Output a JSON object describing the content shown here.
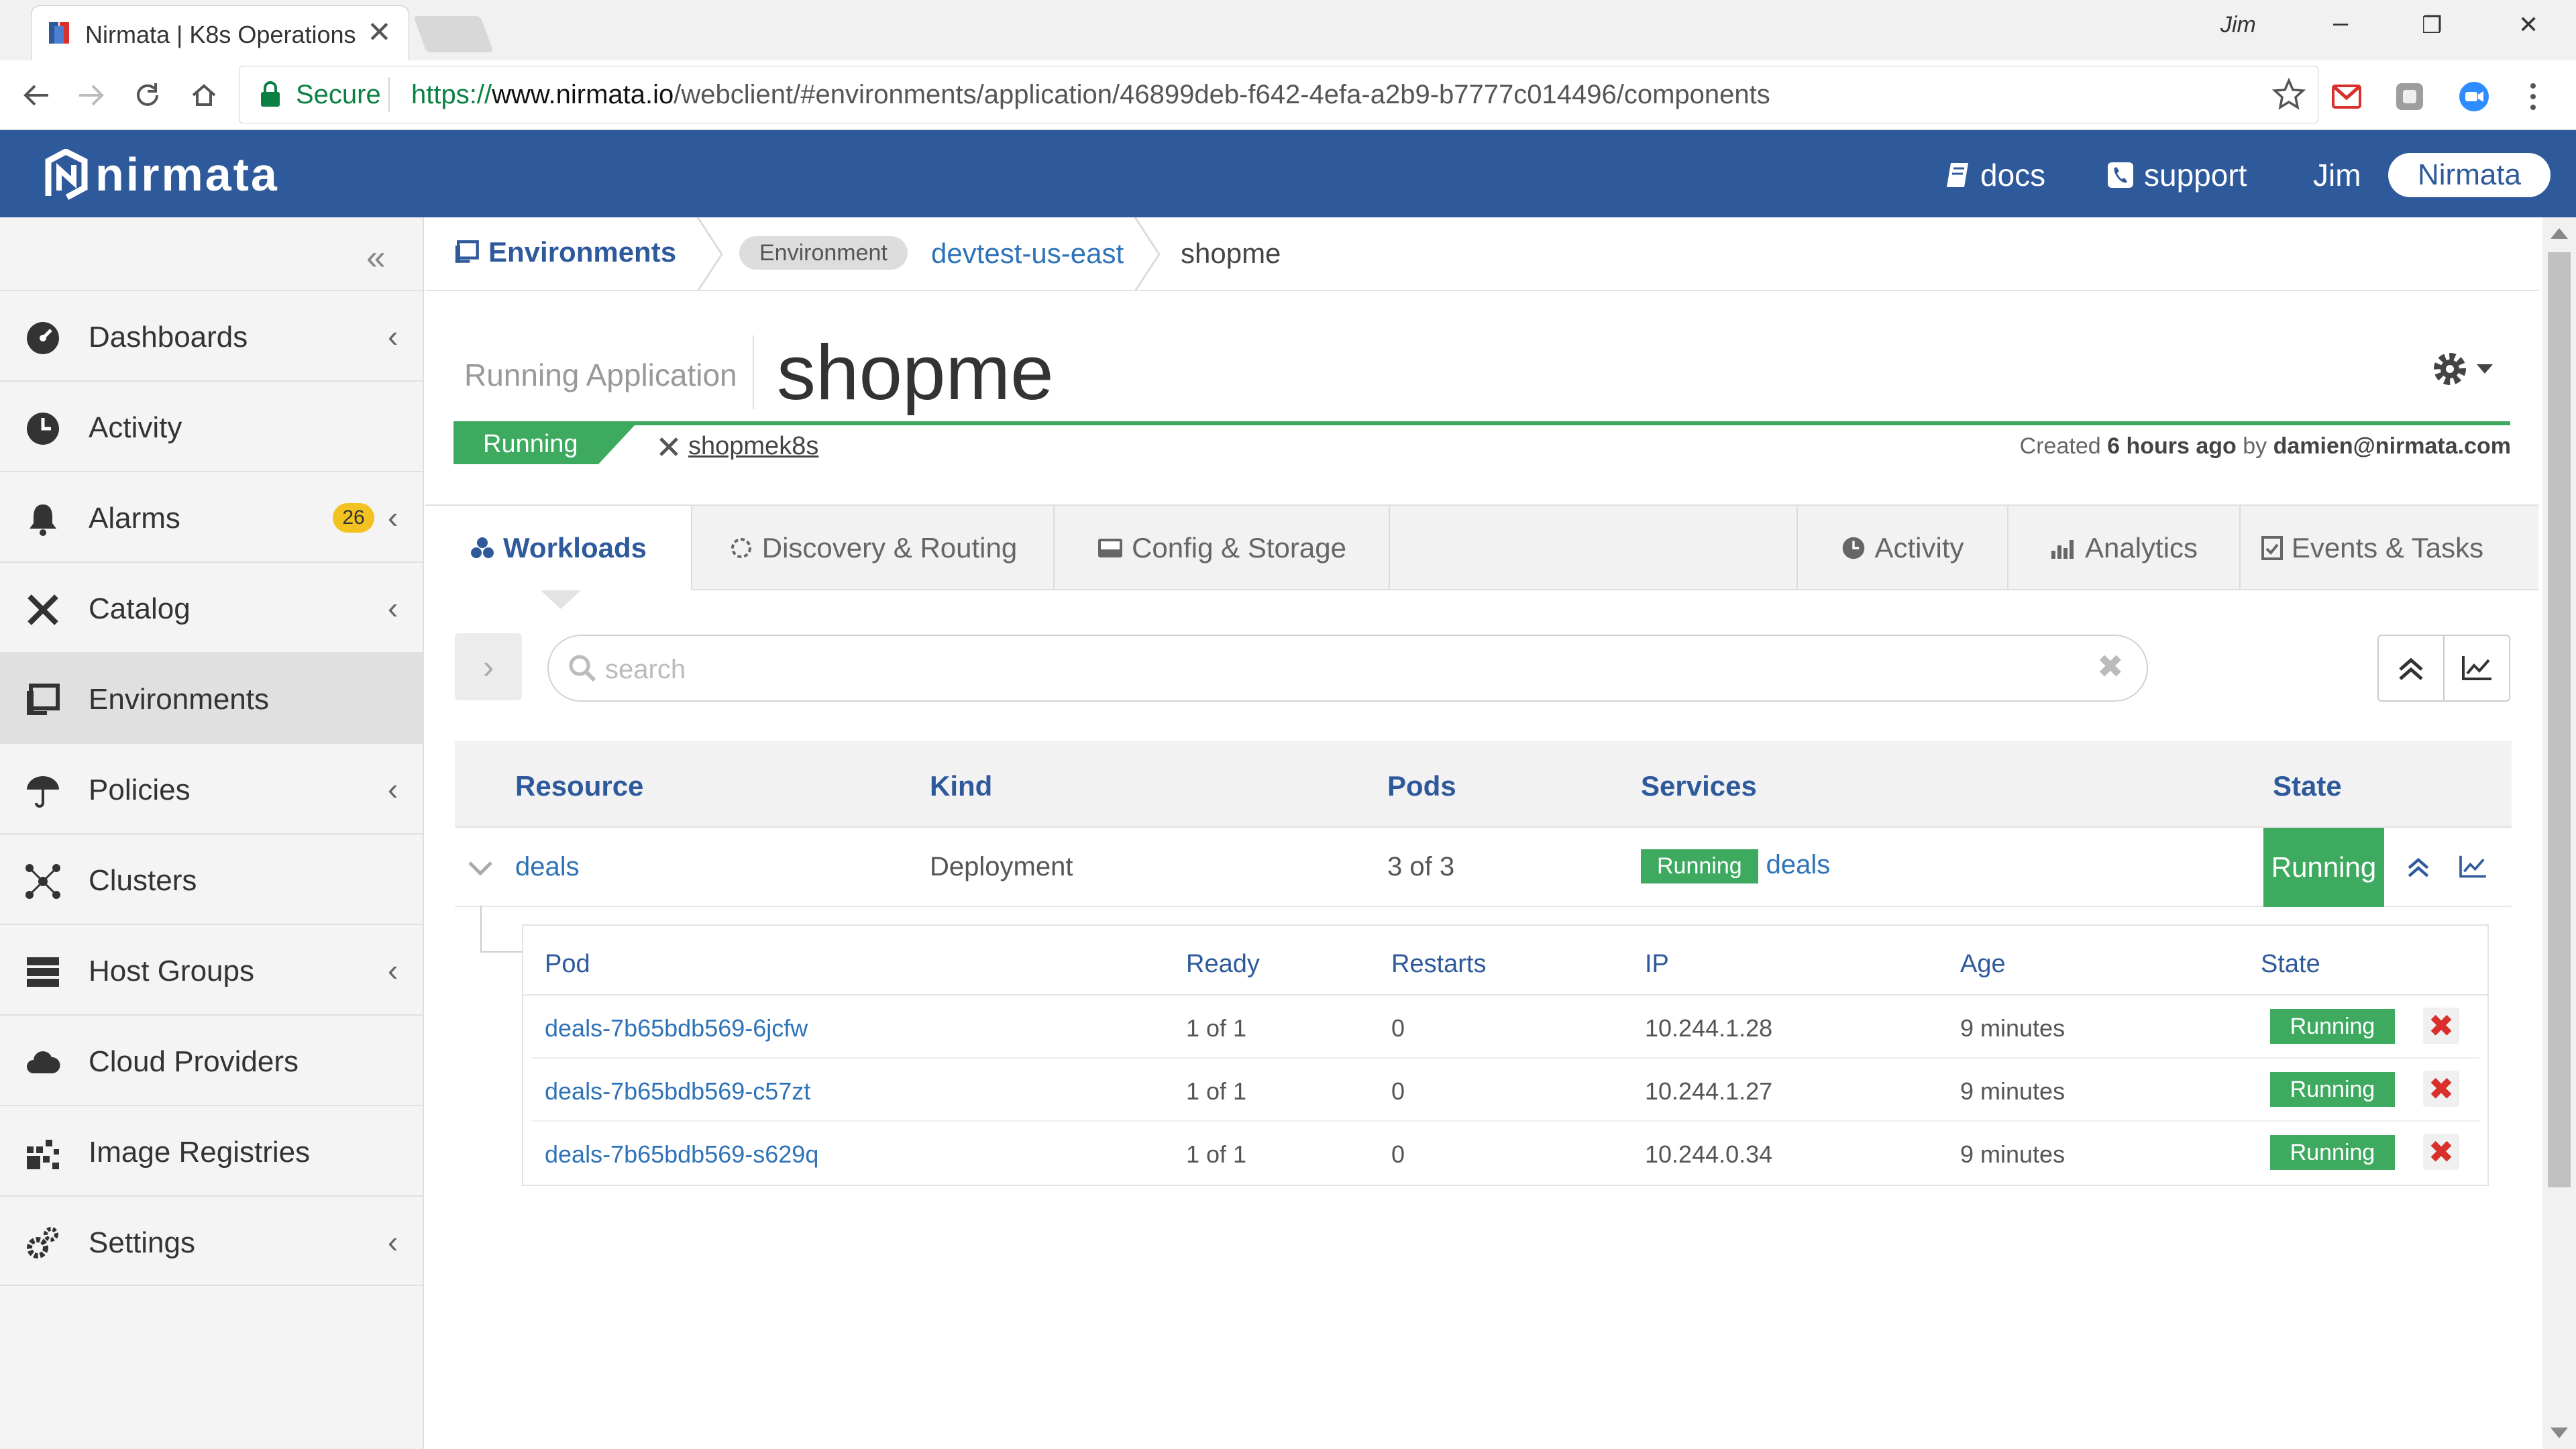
{
  "browser": {
    "tab_title": "Nirmata | K8s Operations",
    "profile_name": "Jim",
    "window_controls": {
      "minimize": "–",
      "restore": "❐",
      "close": "✕"
    },
    "tab_close": "✕",
    "omnibox": {
      "secure_label": "Secure",
      "url_scheme": "https://",
      "url_host": "www.nirmata.io",
      "url_path": "/webclient/#environments/application/46899deb-f642-4efa-a2b9-b7777c014496/components"
    }
  },
  "header": {
    "logo_text": "nirmata",
    "docs_label": "docs",
    "support_label": "support",
    "user_name": "Jim",
    "org_label": "Nirmata",
    "brand_color": "#2e5a9c"
  },
  "sidebar": {
    "collapse_glyph": "«",
    "items": [
      {
        "label": "Dashboards",
        "icon": "dashboard-icon",
        "chevron": "‹"
      },
      {
        "label": "Activity",
        "icon": "clock-icon"
      },
      {
        "label": "Alarms",
        "icon": "bell-icon",
        "badge": "26",
        "chevron": "‹"
      },
      {
        "label": "Catalog",
        "icon": "tools-icon",
        "chevron": "‹"
      },
      {
        "label": "Environments",
        "icon": "environment-icon",
        "active": true
      },
      {
        "label": "Policies",
        "icon": "umbrella-icon",
        "chevron": "‹"
      },
      {
        "label": "Clusters",
        "icon": "cluster-icon"
      },
      {
        "label": "Host Groups",
        "icon": "server-icon",
        "chevron": "‹"
      },
      {
        "label": "Cloud Providers",
        "icon": "cloud-icon"
      },
      {
        "label": "Image Registries",
        "icon": "registry-icon"
      },
      {
        "label": "Settings",
        "icon": "cogs-icon",
        "chevron": "‹"
      }
    ]
  },
  "breadcrumb": {
    "root": "Environments",
    "pill": "Environment",
    "env_link": "devtest-us-east",
    "current": "shopme"
  },
  "app": {
    "kind_label": "Running Application",
    "name": "shopme",
    "status": "Running",
    "cluster": "shopmek8s",
    "created_prefix": "Created",
    "created_when": "6 hours ago",
    "created_by_word": "by",
    "created_by": "damien@nirmata.com"
  },
  "tabs": {
    "workloads": "Workloads",
    "discovery": "Discovery & Routing",
    "config": "Config & Storage",
    "activity": "Activity",
    "analytics": "Analytics",
    "events": "Events & Tasks"
  },
  "search": {
    "placeholder": "search",
    "value": "",
    "clear_glyph": "✖",
    "expand_glyph": "›"
  },
  "resources": {
    "headers": {
      "resource": "Resource",
      "kind": "Kind",
      "pods": "Pods",
      "services": "Services",
      "state": "State"
    },
    "rows": [
      {
        "resource": "deals",
        "kind": "Deployment",
        "pods": "3 of 3",
        "service_status": "Running",
        "service_name": "deals",
        "state": "Running"
      }
    ]
  },
  "pods": {
    "headers": {
      "pod": "Pod",
      "ready": "Ready",
      "restarts": "Restarts",
      "ip": "IP",
      "age": "Age",
      "state": "State"
    },
    "delete_glyph": "✖",
    "rows": [
      {
        "name": "deals-7b65bdb569-6jcfw",
        "ready": "1 of 1",
        "restarts": "0",
        "ip": "10.244.1.28",
        "age": "9 minutes",
        "state": "Running"
      },
      {
        "name": "deals-7b65bdb569-c57zt",
        "ready": "1 of 1",
        "restarts": "0",
        "ip": "10.244.1.27",
        "age": "9 minutes",
        "state": "Running"
      },
      {
        "name": "deals-7b65bdb569-s629q",
        "ready": "1 of 1",
        "restarts": "0",
        "ip": "10.244.0.34",
        "age": "9 minutes",
        "state": "Running"
      }
    ]
  },
  "colors": {
    "running": "#3daa5f",
    "link": "#2e73b8",
    "delete": "#d9302c",
    "badge": "#f3c221"
  }
}
